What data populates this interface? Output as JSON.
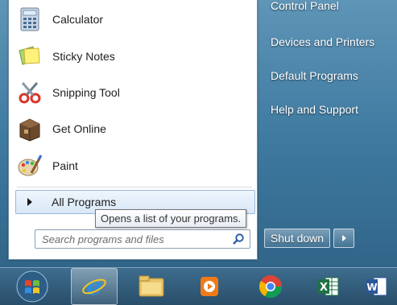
{
  "start_menu": {
    "programs": [
      {
        "label": "Calculator",
        "icon": "calculator-icon"
      },
      {
        "label": "Sticky Notes",
        "icon": "sticky-notes-icon"
      },
      {
        "label": "Snipping Tool",
        "icon": "scissors-icon"
      },
      {
        "label": "Get Online",
        "icon": "package-icon"
      },
      {
        "label": "Paint",
        "icon": "palette-icon"
      }
    ],
    "all_programs_label": "All Programs",
    "tooltip": "Opens a list of your programs.",
    "search_placeholder": "Search programs and files"
  },
  "right_pane": {
    "links": [
      "Control Panel",
      "Devices and Printers",
      "Default Programs",
      "Help and Support"
    ],
    "shutdown_label": "Shut down"
  },
  "taskbar": {
    "items": [
      {
        "name": "start-orb",
        "icon": "windows-logo-icon"
      },
      {
        "name": "internet-explorer",
        "icon": "ie-icon"
      },
      {
        "name": "file-explorer",
        "icon": "folder-icon"
      },
      {
        "name": "media-player",
        "icon": "media-player-icon"
      },
      {
        "name": "chrome",
        "icon": "chrome-icon"
      },
      {
        "name": "excel",
        "icon": "excel-icon"
      },
      {
        "name": "word",
        "icon": "word-icon"
      }
    ]
  },
  "colors": {
    "accent": "#3e6d8e",
    "highlight": "#d9e8f7"
  }
}
